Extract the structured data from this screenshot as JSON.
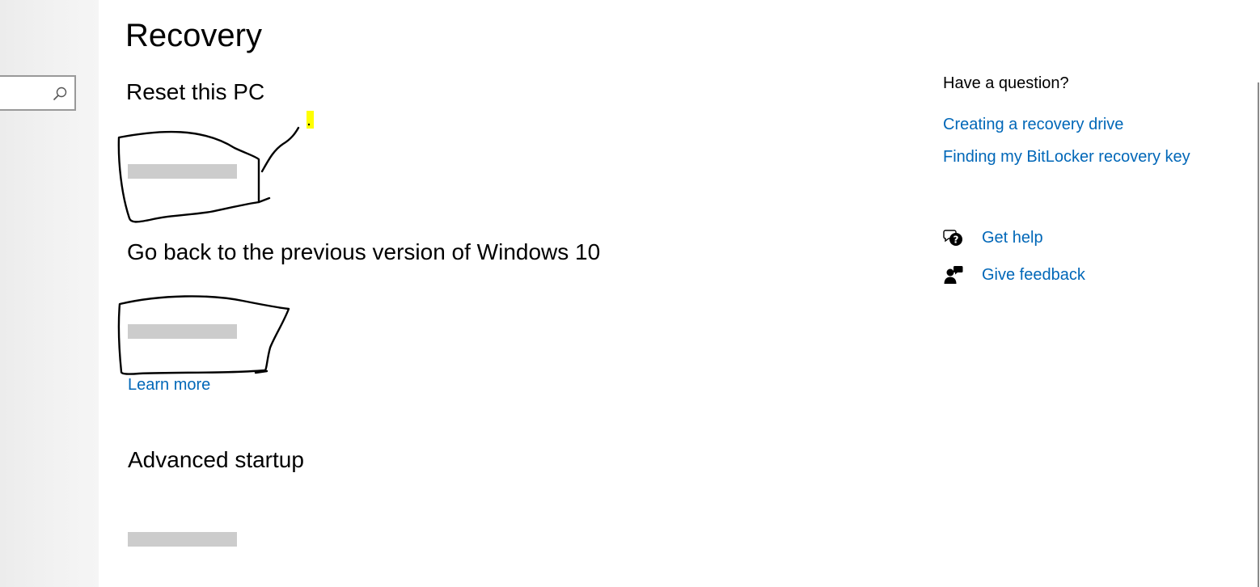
{
  "page": {
    "title": "Recovery"
  },
  "sections": {
    "reset": {
      "title": "Reset this PC"
    },
    "go_back": {
      "title": "Go back to the previous version of Windows 10",
      "learn_more": "Learn more"
    },
    "advanced": {
      "title": "Advanced startup"
    }
  },
  "help_panel": {
    "heading": "Have a question?",
    "links": [
      "Creating a recovery drive",
      "Finding my BitLocker recovery key"
    ],
    "get_help": "Get help",
    "give_feedback": "Give feedback"
  },
  "icons": {
    "search": "search-icon",
    "help": "help-chat-icon",
    "feedback": "feedback-person-icon"
  },
  "colors": {
    "link": "#0067b8",
    "highlight": "#ffff00",
    "sidebar": "#f0f0f0"
  }
}
